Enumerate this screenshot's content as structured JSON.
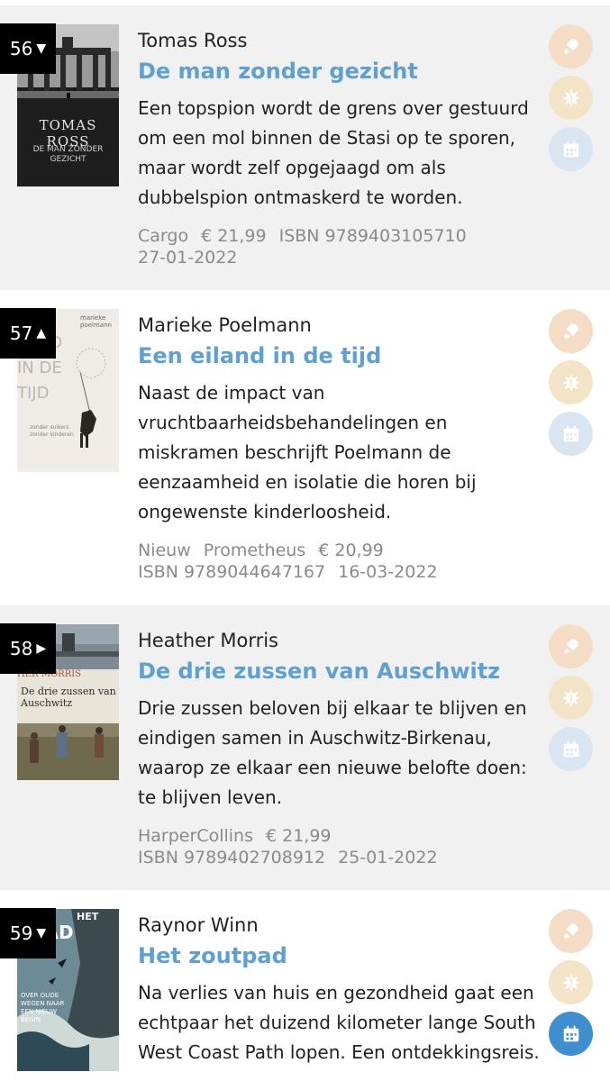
{
  "entries": [
    {
      "rank": "56",
      "trend": "▼",
      "author": "Tomas Ross",
      "title": "De man zonder gezicht",
      "description": "Een topspion wordt de grens over gestuurd om een mol binnen de Stasi op te sporen, maar wordt zelf opgejaagd om als dubbelspion ontmaskerd te worden.",
      "meta_line1": [
        "Cargo",
        "€ 21,99",
        "ISBN 9789403105710"
      ],
      "meta_line2": [
        "27-01-2022"
      ],
      "cover": {
        "author": "TOMAS ROSS",
        "title": "DE MAN ZONDER GEZICHT"
      },
      "calendar_active": false
    },
    {
      "rank": "57",
      "trend": "▲",
      "author": "Marieke Poelmann",
      "title": "Een eiland in de tijd",
      "description": "Naast de impact van vruchtbaarheidsbehandelingen en miskramen beschrijft Poelmann de eenzaamheid en isolatie die horen bij ongewenste kinderloosheid.",
      "meta_line1": [
        "Nieuw",
        "Prometheus",
        "€ 20,99"
      ],
      "meta_line2": [
        "ISBN 9789044647167",
        "16-03-2022"
      ],
      "cover": {
        "author": "marieke poelmann",
        "title": "LAND IN DE TIJD",
        "subtitle": "zonder suikers zonder kinderen"
      },
      "calendar_active": false
    },
    {
      "rank": "58",
      "trend": "▶",
      "author": "Heather Morris",
      "title": "De drie zussen van Auschwitz",
      "description": "Drie zussen beloven bij elkaar te blijven en eindigen samen in Auschwitz-Birkenau, waarop ze elkaar een nieuwe belofte doen: te blijven leven.",
      "meta_line1": [
        "HarperCollins",
        "€ 21,99"
      ],
      "meta_line2": [
        "ISBN 9789402708912",
        "25-01-2022"
      ],
      "cover": {
        "author": "HER MORRIS",
        "title": "De drie zussen van Auschwitz"
      },
      "calendar_active": false
    },
    {
      "rank": "59",
      "trend": "▼",
      "author": "Raynor Winn",
      "title": "Het zoutpad",
      "description": "Na verlies van huis en gezondheid gaat een echtpaar het duizend kilometer lange South West Coast Path lopen. Een ontdekkingsreis.",
      "meta_line1": [],
      "meta_line2": [],
      "cover": {
        "author": "HET",
        "title": "TPAD",
        "subtitle": "OVER OUDE WEGEN NAAR EEN NIEUW BEGIN"
      },
      "calendar_active": true
    }
  ],
  "colors": {
    "title_blue": "#5ea0d2",
    "rocket_bg": "#f5dcc6",
    "burst_bg": "#f4e4c7",
    "calendar_bg": "#d9e6f2",
    "calendar_active_bg": "#3f8fd0"
  },
  "icons": [
    "rocket-icon",
    "burst-icon",
    "calendar-icon"
  ]
}
